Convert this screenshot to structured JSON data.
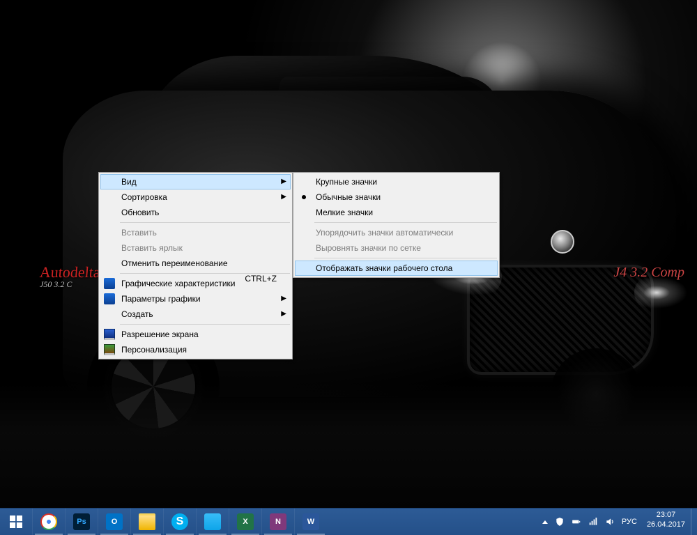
{
  "wallpaper": {
    "decal_left_line1": "Autodelta",
    "decal_left_line2": "J50 3.2 C",
    "decal_right": "J4 3.2 Comp"
  },
  "context_menu": {
    "view": "Вид",
    "sort": "Сортировка",
    "refresh": "Обновить",
    "paste": "Вставить",
    "paste_shortcut_item": "Вставить ярлык",
    "undo_rename": "Отменить переименование",
    "undo_shortcut": "CTRL+Z",
    "gfx_chars": "Графические характеристики",
    "gfx_params": "Параметры графики",
    "create": "Создать",
    "screen_res": "Разрешение экрана",
    "personalization": "Персонализация"
  },
  "view_submenu": {
    "large": "Крупные значки",
    "medium": "Обычные значки",
    "small": "Мелкие значки",
    "auto_arrange": "Упорядочить значки автоматически",
    "align_grid": "Выровнять значки по сетке",
    "show_icons": "Отображать значки рабочего стола"
  },
  "taskbar": {
    "apps": {
      "chrome": "Google Chrome",
      "photoshop_label": "Ps",
      "outlook_label": "O",
      "skype_label": "S",
      "excel_label": "X",
      "onenote_label": "N",
      "word_label": "W"
    }
  },
  "tray": {
    "language": "РУС",
    "time": "23:07",
    "date": "26.04.2017"
  }
}
